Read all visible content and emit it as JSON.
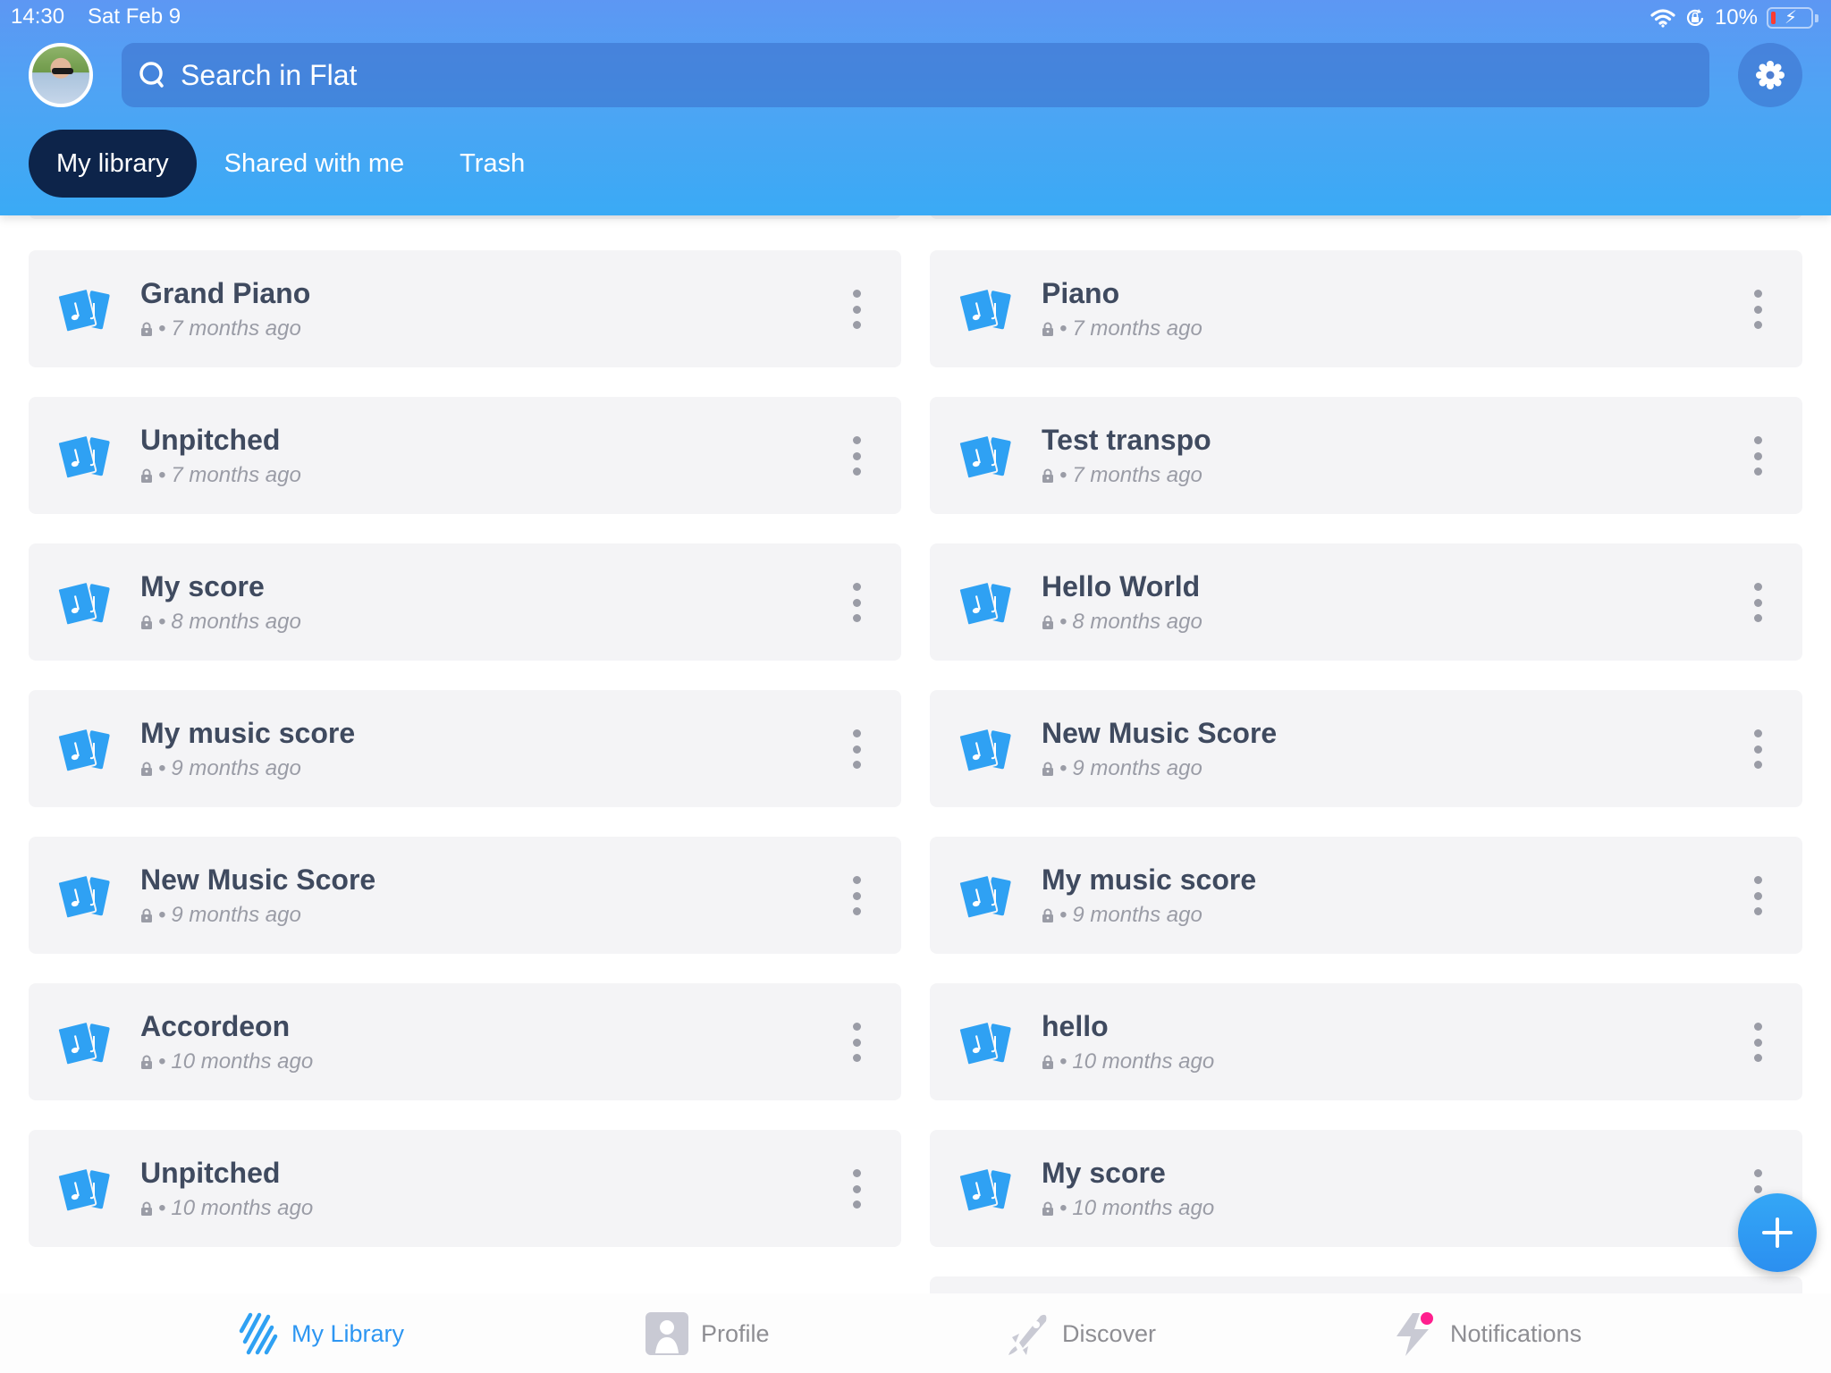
{
  "status_bar": {
    "time": "14:30",
    "date": "Sat Feb 9",
    "battery": "10%",
    "icons": [
      "wifi-icon",
      "orientation-lock-icon",
      "battery-charging-icon"
    ]
  },
  "header": {
    "avatar_alt": "User avatar",
    "search": {
      "placeholder": "Search in Flat",
      "value": ""
    },
    "settings_icon": "gear-icon",
    "tabs": [
      {
        "label": "My library",
        "active": true
      },
      {
        "label": "Shared with me",
        "active": false
      },
      {
        "label": "Trash",
        "active": false
      }
    ]
  },
  "scores": [
    {
      "title": "Grand Piano",
      "meta": "7 months ago",
      "privacy": "private"
    },
    {
      "title": "Piano",
      "meta": "7 months ago",
      "privacy": "private"
    },
    {
      "title": "Unpitched",
      "meta": "7 months ago",
      "privacy": "private"
    },
    {
      "title": "Test transpo",
      "meta": "7 months ago",
      "privacy": "private"
    },
    {
      "title": "My score",
      "meta": "8 months ago",
      "privacy": "private"
    },
    {
      "title": "Hello World",
      "meta": "8 months ago",
      "privacy": "private"
    },
    {
      "title": "My music score",
      "meta": "9 months ago",
      "privacy": "private"
    },
    {
      "title": "New Music Score",
      "meta": "9 months ago",
      "privacy": "private"
    },
    {
      "title": "New Music Score",
      "meta": "9 months ago",
      "privacy": "private"
    },
    {
      "title": "My music score",
      "meta": "9 months ago",
      "privacy": "private"
    },
    {
      "title": "Accordeon",
      "meta": "10 months ago",
      "privacy": "private"
    },
    {
      "title": "hello",
      "meta": "10 months ago",
      "privacy": "private"
    },
    {
      "title": "Unpitched",
      "meta": "10 months ago",
      "privacy": "private"
    },
    {
      "title": "My score",
      "meta": "10 months ago",
      "privacy": "private"
    }
  ],
  "separator": "•",
  "fab": {
    "icon": "plus-icon"
  },
  "tabbar": [
    {
      "label": "My Library",
      "icon": "library-icon",
      "active": true
    },
    {
      "label": "Profile",
      "icon": "profile-icon",
      "active": false
    },
    {
      "label": "Discover",
      "icon": "rocket-icon",
      "active": false
    },
    {
      "label": "Notifications",
      "icon": "lightning-icon",
      "active": false,
      "badge": true
    }
  ],
  "colors": {
    "accent": "#2d96f2",
    "active_tab_bg": "#0d244a",
    "card_bg": "#f4f4f6",
    "title_text": "#3f4a5f",
    "meta_text": "#9a9ca6",
    "badge": "#ff1f8e",
    "battery_low": "#ff3b30"
  }
}
